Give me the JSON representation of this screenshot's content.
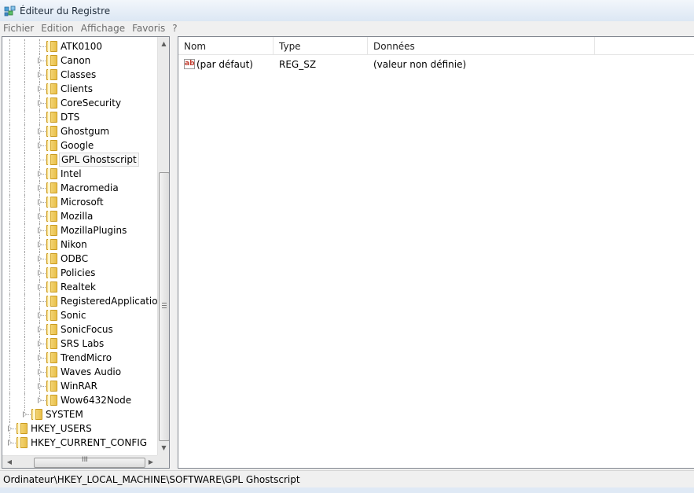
{
  "window": {
    "title": "Éditeur du Registre"
  },
  "menu": [
    {
      "label": "Fichier"
    },
    {
      "label": "Edition"
    },
    {
      "label": "Affichage"
    },
    {
      "label": "Favoris"
    },
    {
      "label": "?"
    }
  ],
  "tree": {
    "items": [
      {
        "label": "ATK0100",
        "depth": 3,
        "expandable": false,
        "last": false
      },
      {
        "label": "Canon",
        "depth": 3,
        "expandable": true,
        "last": false
      },
      {
        "label": "Classes",
        "depth": 3,
        "expandable": true,
        "last": false
      },
      {
        "label": "Clients",
        "depth": 3,
        "expandable": true,
        "last": false
      },
      {
        "label": "CoreSecurity",
        "depth": 3,
        "expandable": true,
        "last": false
      },
      {
        "label": "DTS",
        "depth": 3,
        "expandable": false,
        "last": false
      },
      {
        "label": "Ghostgum",
        "depth": 3,
        "expandable": true,
        "last": false
      },
      {
        "label": "Google",
        "depth": 3,
        "expandable": true,
        "last": false
      },
      {
        "label": "GPL Ghostscript",
        "depth": 3,
        "expandable": false,
        "last": false,
        "selected": true
      },
      {
        "label": "Intel",
        "depth": 3,
        "expandable": true,
        "last": false
      },
      {
        "label": "Macromedia",
        "depth": 3,
        "expandable": true,
        "last": false
      },
      {
        "label": "Microsoft",
        "depth": 3,
        "expandable": true,
        "last": false
      },
      {
        "label": "Mozilla",
        "depth": 3,
        "expandable": true,
        "last": false
      },
      {
        "label": "MozillaPlugins",
        "depth": 3,
        "expandable": true,
        "last": false
      },
      {
        "label": "Nikon",
        "depth": 3,
        "expandable": true,
        "last": false
      },
      {
        "label": "ODBC",
        "depth": 3,
        "expandable": true,
        "last": false
      },
      {
        "label": "Policies",
        "depth": 3,
        "expandable": true,
        "last": false
      },
      {
        "label": "Realtek",
        "depth": 3,
        "expandable": true,
        "last": false
      },
      {
        "label": "RegisteredApplications",
        "depth": 3,
        "expandable": false,
        "last": false
      },
      {
        "label": "Sonic",
        "depth": 3,
        "expandable": true,
        "last": false
      },
      {
        "label": "SonicFocus",
        "depth": 3,
        "expandable": true,
        "last": false
      },
      {
        "label": "SRS Labs",
        "depth": 3,
        "expandable": true,
        "last": false
      },
      {
        "label": "TrendMicro",
        "depth": 3,
        "expandable": true,
        "last": false
      },
      {
        "label": "Waves Audio",
        "depth": 3,
        "expandable": true,
        "last": false
      },
      {
        "label": "WinRAR",
        "depth": 3,
        "expandable": true,
        "last": false
      },
      {
        "label": "Wow6432Node",
        "depth": 3,
        "expandable": true,
        "last": true
      },
      {
        "label": "SYSTEM",
        "depth": 2,
        "expandable": true,
        "last": true
      },
      {
        "label": "HKEY_USERS",
        "depth": 1,
        "expandable": true,
        "last": false
      },
      {
        "label": "HKEY_CURRENT_CONFIG",
        "depth": 1,
        "expandable": true,
        "last": true
      }
    ]
  },
  "list": {
    "columns": [
      {
        "label": "Nom"
      },
      {
        "label": "Type"
      },
      {
        "label": "Données"
      }
    ],
    "rows": [
      {
        "icon": "string-value-icon",
        "icon_text": "ab",
        "name": "(par défaut)",
        "type": "REG_SZ",
        "data": "(valeur non définie)"
      }
    ]
  },
  "scroll": {
    "h_grip": "III"
  },
  "status": {
    "path": "Ordinateur\\HKEY_LOCAL_MACHINE\\SOFTWARE\\GPL Ghostscript"
  },
  "colors": {
    "folder": "#f0cf5e",
    "selection_border": "#d9d9d9",
    "chrome": "#dfe9f5"
  }
}
